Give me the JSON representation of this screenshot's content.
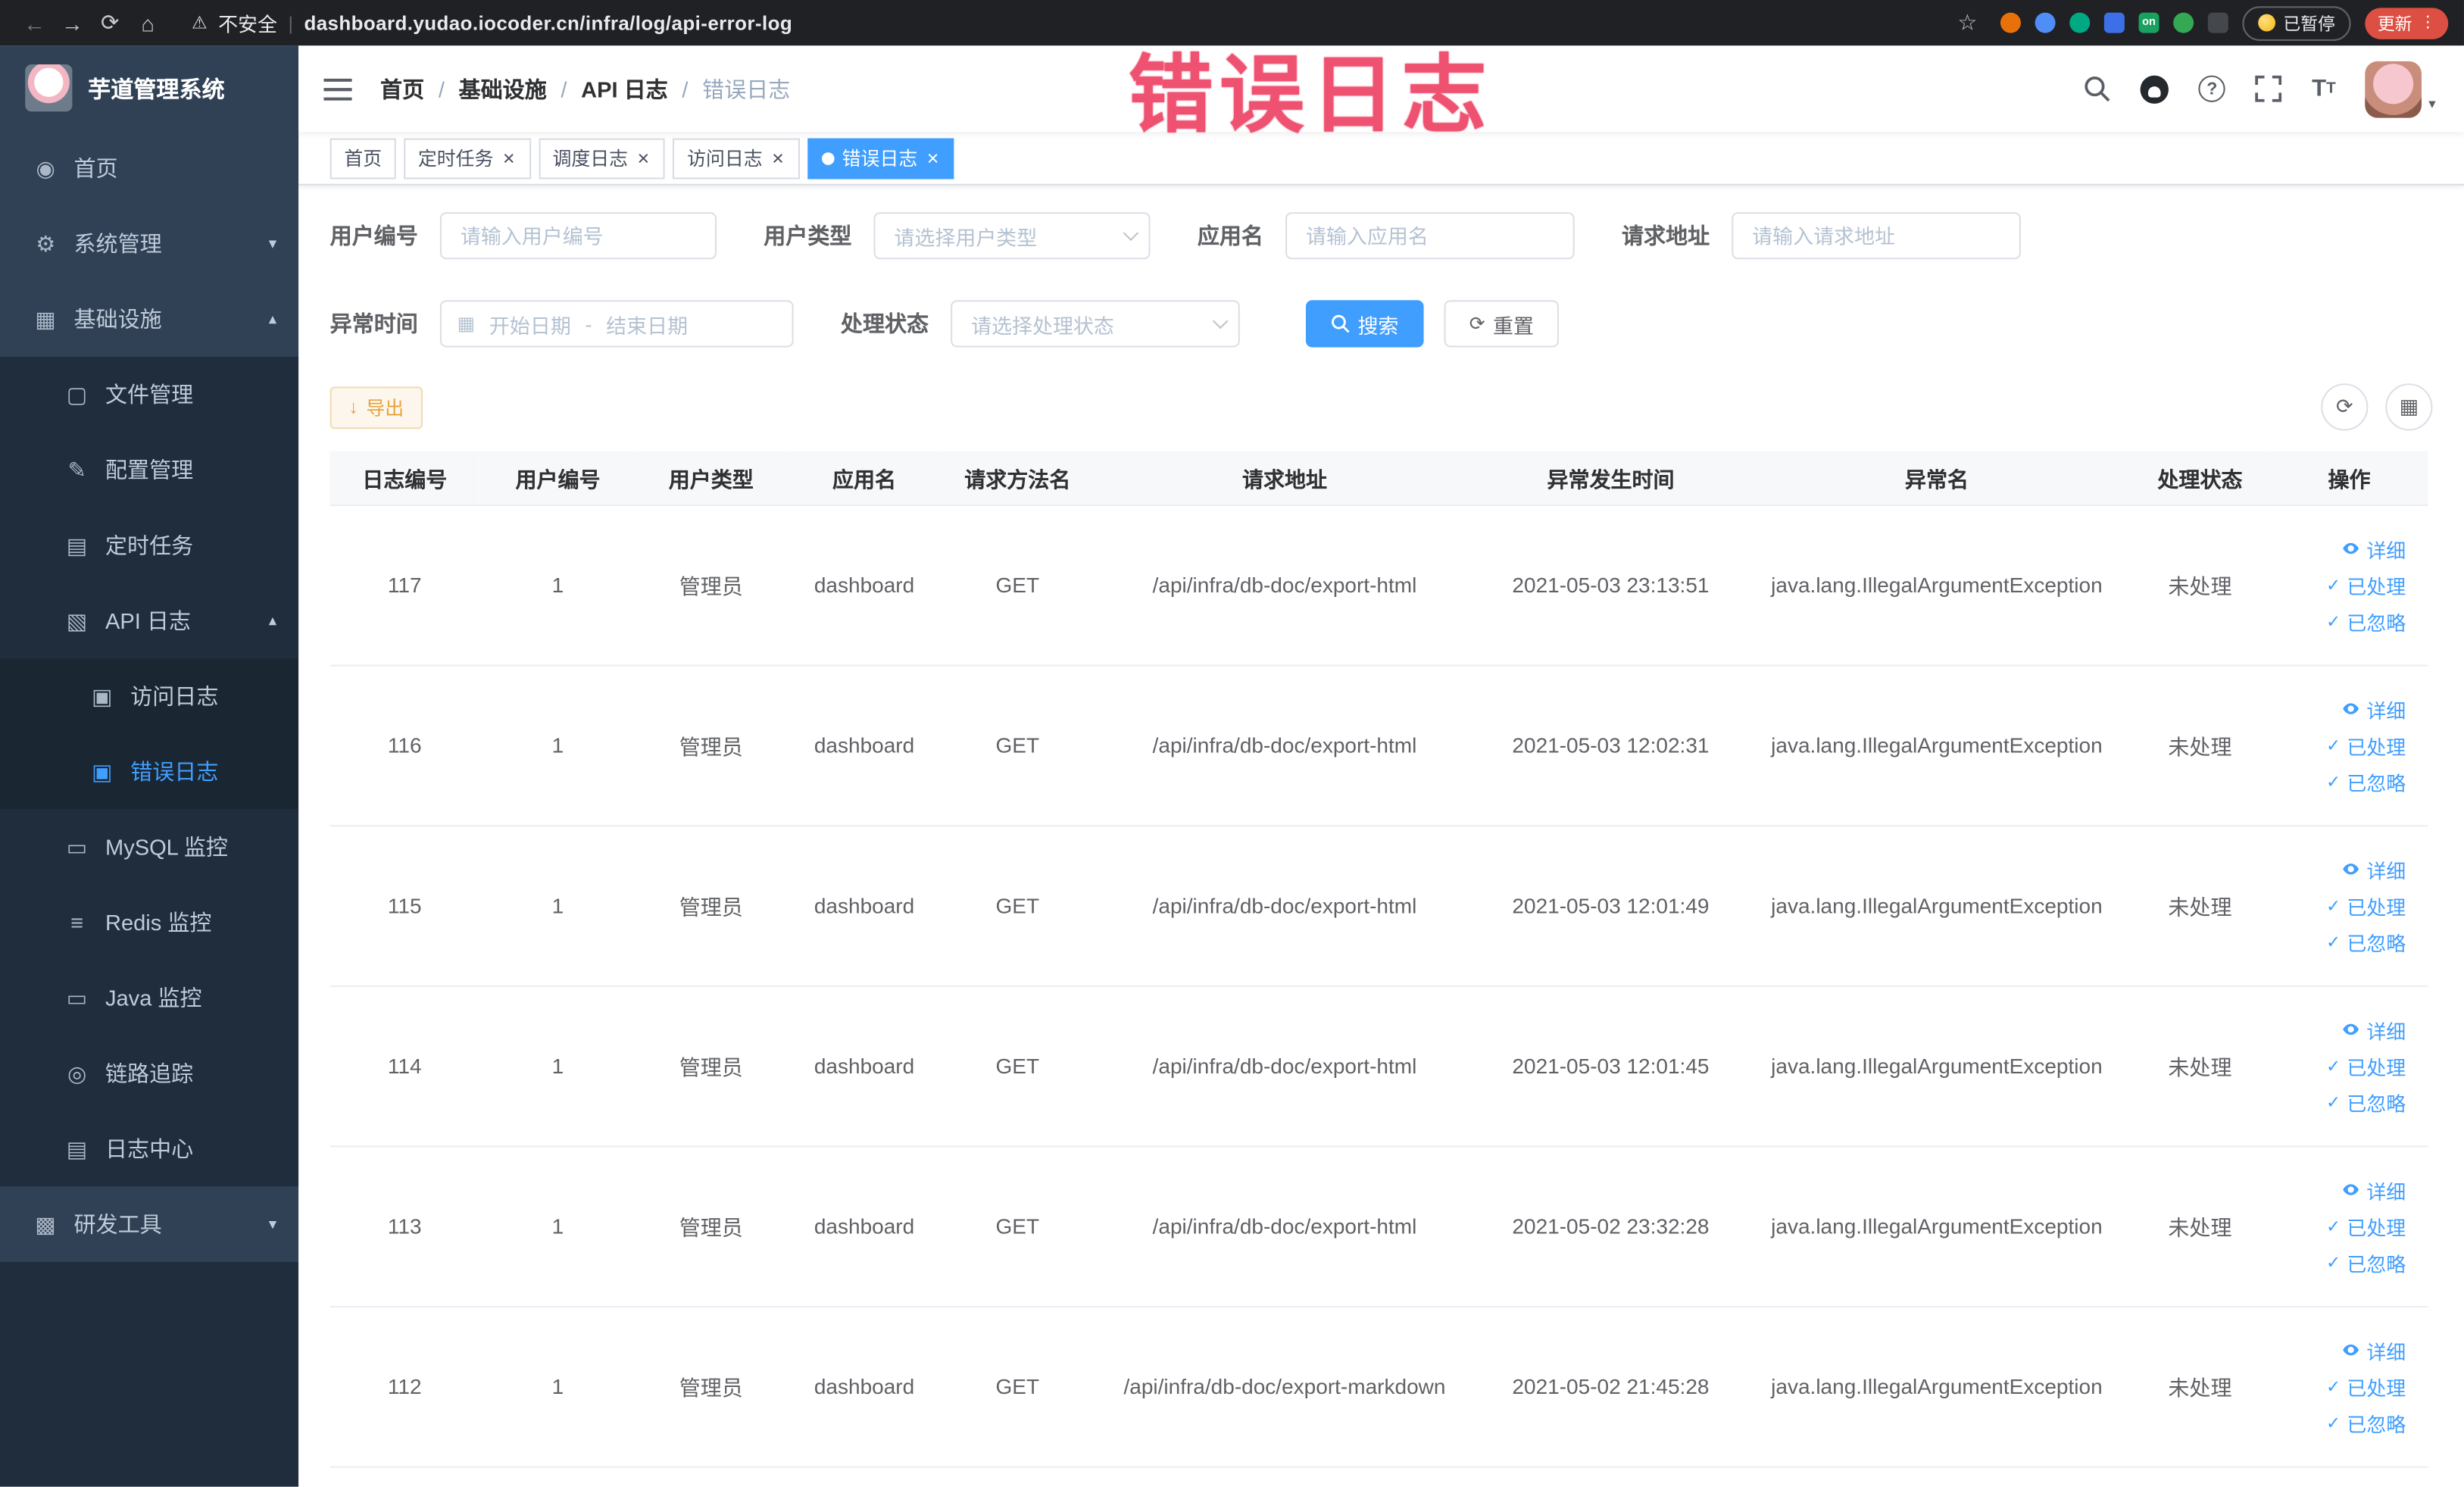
{
  "glyphs": {
    "back": "←",
    "forward": "→",
    "reload": "⟳",
    "home": "⌂",
    "star": "☆",
    "warning": "⚠",
    "menu_dots": "⋮",
    "divider": "|",
    "chevron_down": "▾",
    "chevron_up": "▴",
    "caret_down": "▾",
    "refresh": "⟳",
    "grid": "▦",
    "download": "↓",
    "calendar": "▦",
    "check": "✓",
    "question": "?",
    "font_big": "T",
    "font_small": "T"
  },
  "browser": {
    "security_label": "不安全",
    "url": "dashboard.yudao.iocoder.cn/infra/log/api-error-log",
    "paused_label": "已暂停",
    "update_label": "更新",
    "extension_badge": "on"
  },
  "overlay": {
    "text": "错误日志"
  },
  "sidebar": {
    "title": "芋道管理系统",
    "items": [
      {
        "icon": "◉",
        "label": "首页"
      },
      {
        "icon": "⚙",
        "label": "系统管理"
      },
      {
        "icon": "▦",
        "label": "基础设施"
      },
      {
        "icon": "▢",
        "label": "文件管理"
      },
      {
        "icon": "✎",
        "label": "配置管理"
      },
      {
        "icon": "▤",
        "label": "定时任务"
      },
      {
        "icon": "▧",
        "label": "API 日志"
      },
      {
        "icon": "▣",
        "label": "访问日志"
      },
      {
        "icon": "▣",
        "label": "错误日志"
      },
      {
        "icon": "▭",
        "label": "MySQL 监控"
      },
      {
        "icon": "≡",
        "label": "Redis 监控"
      },
      {
        "icon": "▭",
        "label": "Java 监控"
      },
      {
        "icon": "◎",
        "label": "链路追踪"
      },
      {
        "icon": "▤",
        "label": "日志中心"
      },
      {
        "icon": "▩",
        "label": "研发工具"
      }
    ]
  },
  "breadcrumb": {
    "separator": "/",
    "items": [
      "首页",
      "基础设施",
      "API 日志",
      "错误日志"
    ]
  },
  "tags": {
    "close_glyph": "×",
    "items": [
      {
        "label": "首页"
      },
      {
        "label": "定时任务"
      },
      {
        "label": "调度日志"
      },
      {
        "label": "访问日志"
      },
      {
        "label": "错误日志"
      }
    ]
  },
  "filters": {
    "user_id": {
      "label": "用户编号",
      "placeholder": "请输入用户编号"
    },
    "user_type": {
      "label": "用户类型",
      "placeholder": "请选择用户类型"
    },
    "app_name": {
      "label": "应用名",
      "placeholder": "请输入应用名"
    },
    "request_url": {
      "label": "请求地址",
      "placeholder": "请输入请求地址"
    },
    "exception_time": {
      "label": "异常时间",
      "start_placeholder": "开始日期",
      "separator": "-",
      "end_placeholder": "结束日期"
    },
    "process_status": {
      "label": "处理状态",
      "placeholder": "请选择处理状态"
    },
    "search_label": "搜索",
    "reset_label": "重置"
  },
  "toolbar": {
    "export_label": "导出"
  },
  "table": {
    "columns": [
      "日志编号",
      "用户编号",
      "用户类型",
      "应用名",
      "请求方法名",
      "请求地址",
      "异常发生时间",
      "异常名",
      "处理状态",
      "操作"
    ],
    "action_labels": {
      "detail": "详细",
      "processed": "已处理",
      "ignored": "已忽略"
    },
    "rows": [
      {
        "id": "117",
        "user_id": "1",
        "user_type": "管理员",
        "app": "dashboard",
        "method": "GET",
        "url": "/api/infra/db-doc/export-html",
        "time": "2021-05-03 23:13:51",
        "exception": "java.lang.IllegalArgumentException",
        "status": "未处理"
      },
      {
        "id": "116",
        "user_id": "1",
        "user_type": "管理员",
        "app": "dashboard",
        "method": "GET",
        "url": "/api/infra/db-doc/export-html",
        "time": "2021-05-03 12:02:31",
        "exception": "java.lang.IllegalArgumentException",
        "status": "未处理"
      },
      {
        "id": "115",
        "user_id": "1",
        "user_type": "管理员",
        "app": "dashboard",
        "method": "GET",
        "url": "/api/infra/db-doc/export-html",
        "time": "2021-05-03 12:01:49",
        "exception": "java.lang.IllegalArgumentException",
        "status": "未处理"
      },
      {
        "id": "114",
        "user_id": "1",
        "user_type": "管理员",
        "app": "dashboard",
        "method": "GET",
        "url": "/api/infra/db-doc/export-html",
        "time": "2021-05-03 12:01:45",
        "exception": "java.lang.IllegalArgumentException",
        "status": "未处理"
      },
      {
        "id": "113",
        "user_id": "1",
        "user_type": "管理员",
        "app": "dashboard",
        "method": "GET",
        "url": "/api/infra/db-doc/export-html",
        "time": "2021-05-02 23:32:28",
        "exception": "java.lang.IllegalArgumentException",
        "status": "未处理"
      },
      {
        "id": "112",
        "user_id": "1",
        "user_type": "管理员",
        "app": "dashboard",
        "method": "GET",
        "url": "/api/infra/db-doc/export-markdown",
        "time": "2021-05-02 21:45:28",
        "exception": "java.lang.IllegalArgumentException",
        "status": "未处理"
      }
    ]
  },
  "colors": {
    "accent": "#409eff",
    "warning": "#e6a23c",
    "overlay_annotation": "#ef5271",
    "sidebar_bg": "#304156",
    "sidebar_sub_bg": "#1f2d3d"
  }
}
